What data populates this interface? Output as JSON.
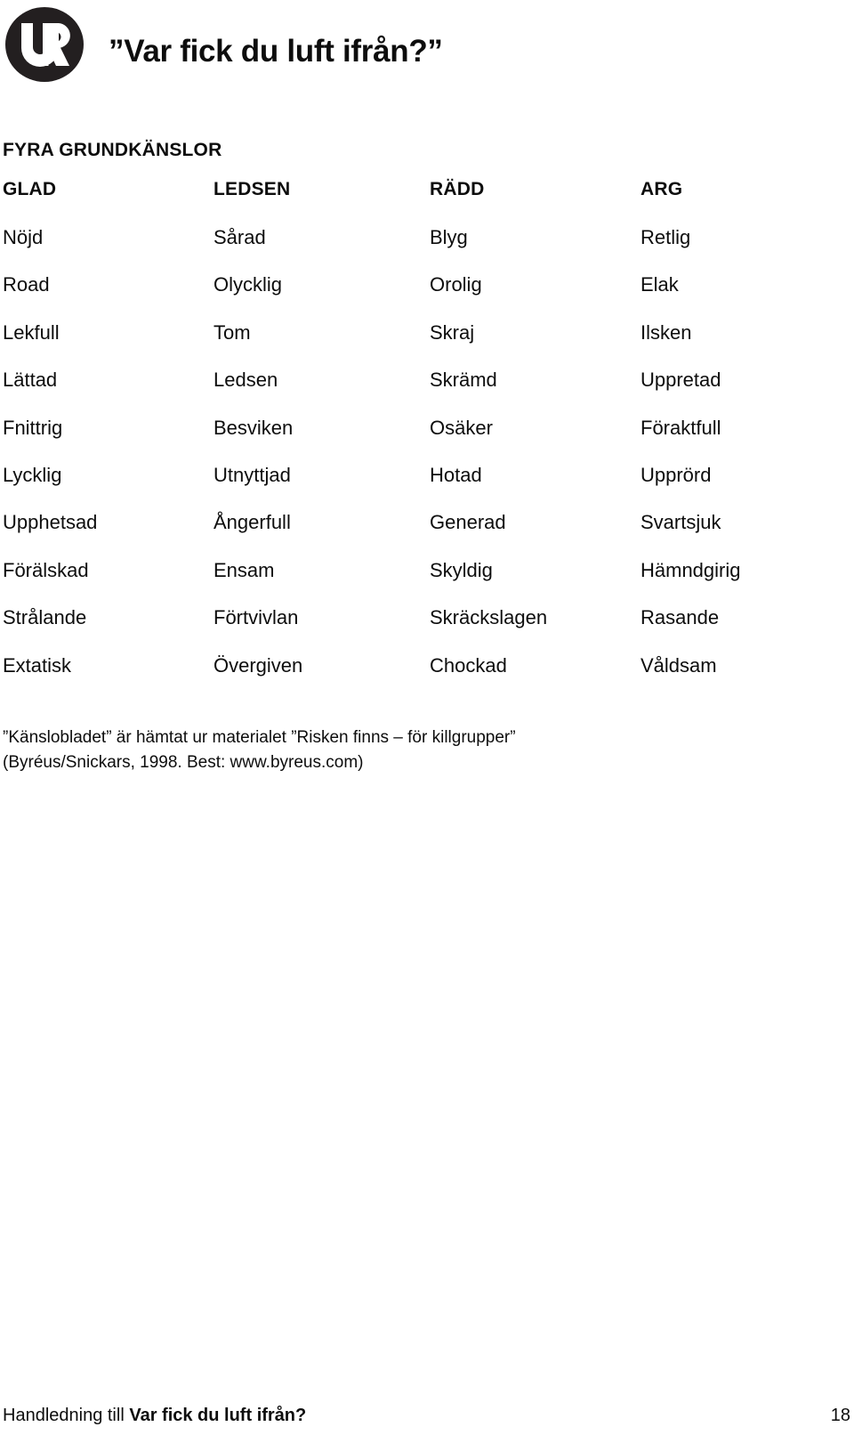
{
  "header": {
    "logo_alt": "UR",
    "logo_letters": "UR",
    "title": "”Var fick du luft ifrån?”"
  },
  "section": {
    "heading": "FYRA GRUNDKÄNSLOR"
  },
  "table": {
    "columns": [
      "GLAD",
      "LEDSEN",
      "RÄDD",
      "ARG"
    ],
    "rows": [
      [
        "Nöjd",
        "Sårad",
        "Blyg",
        "Retlig"
      ],
      [
        "Road",
        "Olycklig",
        "Orolig",
        "Elak"
      ],
      [
        "Lekfull",
        "Tom",
        "Skraj",
        "Ilsken"
      ],
      [
        "Lättad",
        "Ledsen",
        "Skrämd",
        "Uppretad"
      ],
      [
        "Fnittrig",
        "Besviken",
        "Osäker",
        "Föraktfull"
      ],
      [
        "Lycklig",
        "Utnyttjad",
        "Hotad",
        "Upprörd"
      ],
      [
        "Upphetsad",
        "Ångerfull",
        "Generad",
        "Svartsjuk"
      ],
      [
        "Förälskad",
        "Ensam",
        "Skyldig",
        "Hämndgirig"
      ],
      [
        "Strålande",
        "Förtvivlan",
        "Skräckslagen",
        "Rasande"
      ],
      [
        "Extatisk",
        "Övergiven",
        "Chockad",
        "Våldsam"
      ]
    ]
  },
  "source_note": {
    "line1": "”Känslobladet” är hämtat ur materialet ”Risken finns – för killgrupper”",
    "line2": "(Byréus/Snickars, 1998. Best: www.byreus.com)"
  },
  "footer": {
    "prefix": "Handledning till ",
    "title": "Var fick du luft ifrån?",
    "page_number": "18"
  },
  "colors": {
    "text": "#0d0d0d",
    "logo_background": "#231f20",
    "logo_foreground": "#ffffff",
    "page_background": "#ffffff"
  }
}
